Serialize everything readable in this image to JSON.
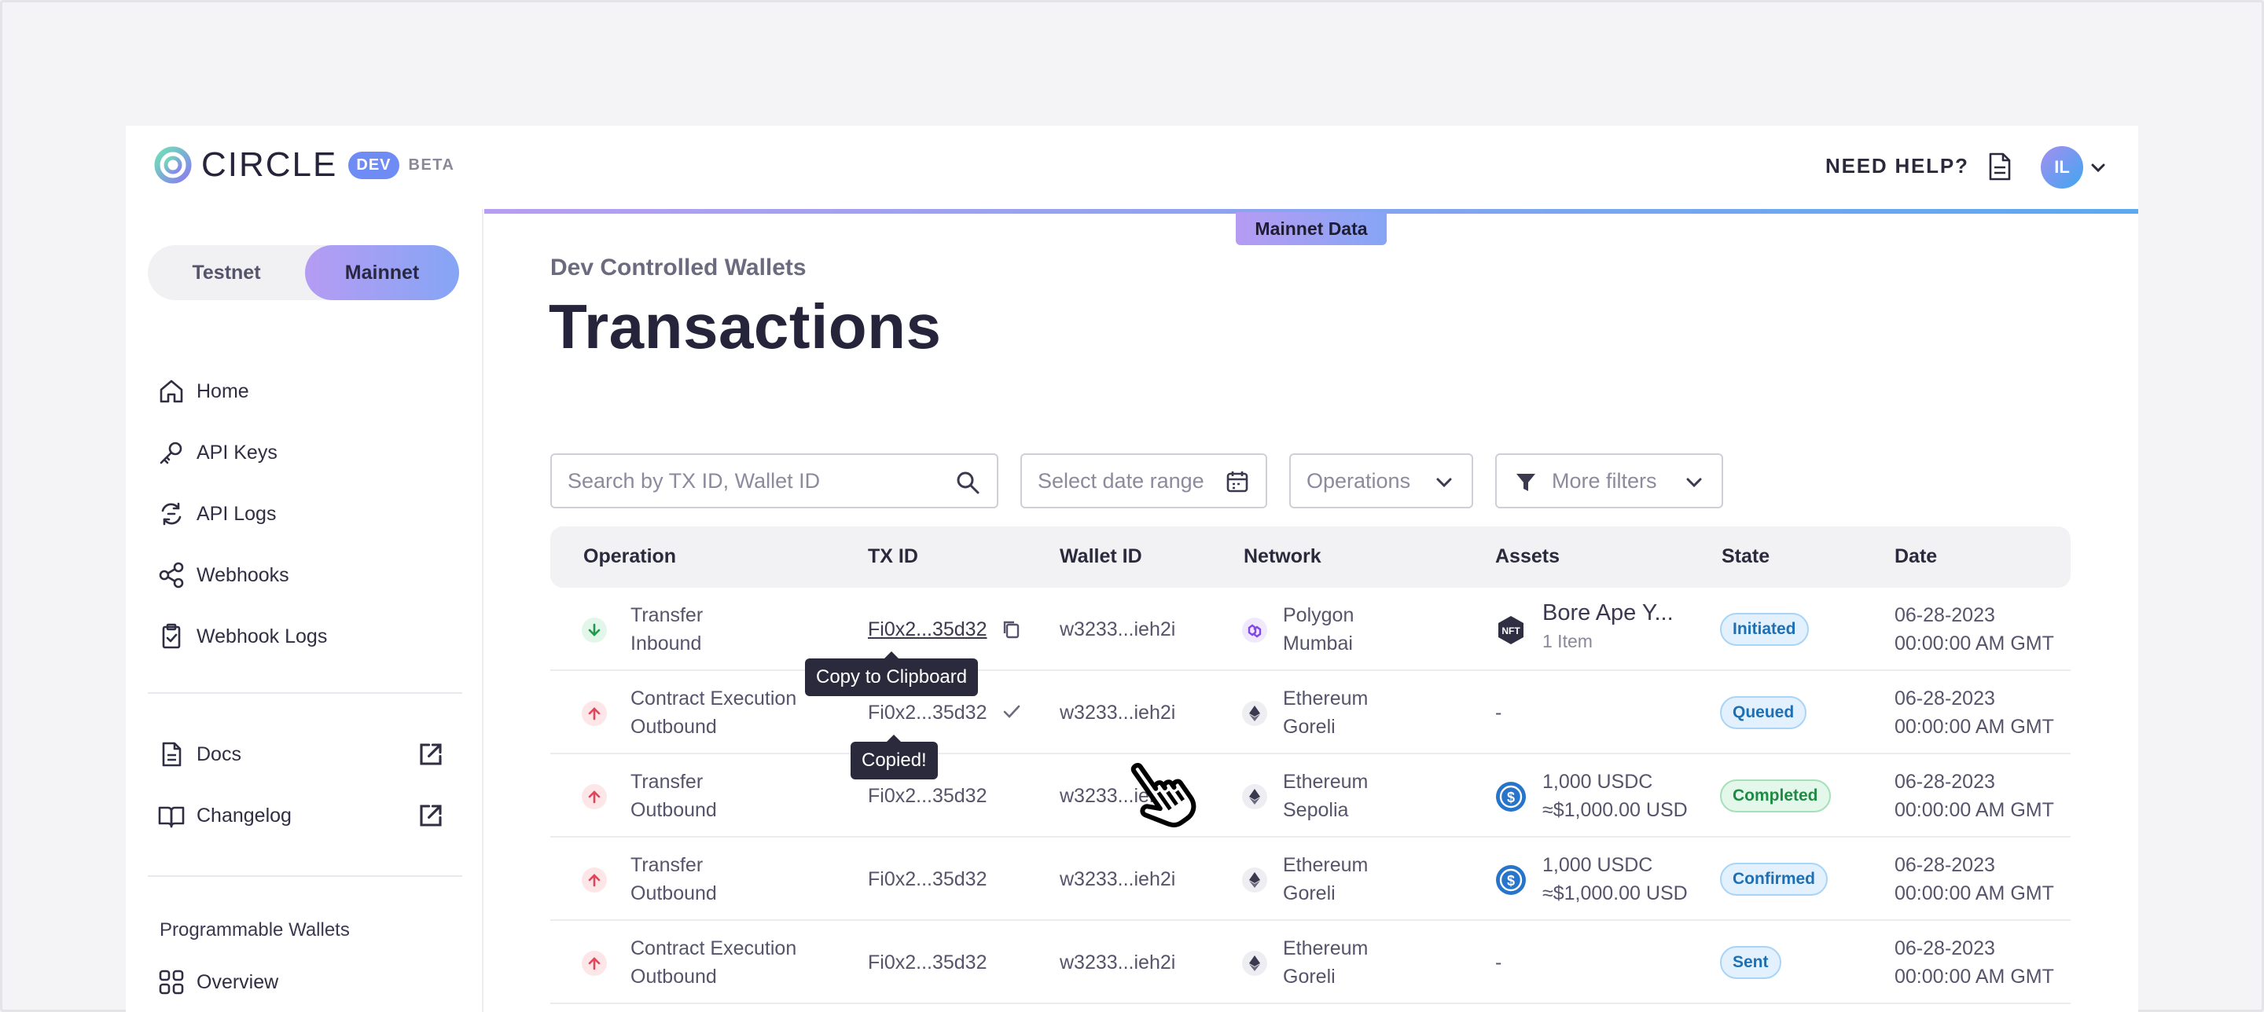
{
  "header": {
    "logo_text": "CIRCLE",
    "dev_badge": "DEV",
    "beta_label": "BETA",
    "help_label": "NEED HELP?",
    "avatar_initials": "IL"
  },
  "sidebar": {
    "network_toggle": {
      "testnet": "Testnet",
      "mainnet": "Mainnet",
      "selected": "Mainnet"
    },
    "items": [
      {
        "label": "Home",
        "icon": "home-icon"
      },
      {
        "label": "API Keys",
        "icon": "key-icon"
      },
      {
        "label": "API Logs",
        "icon": "refresh-log-icon"
      },
      {
        "label": "Webhooks",
        "icon": "webhook-icon"
      },
      {
        "label": "Webhook Logs",
        "icon": "clipboard-icon"
      }
    ],
    "external": [
      {
        "label": "Docs",
        "icon": "document-icon"
      },
      {
        "label": "Changelog",
        "icon": "book-icon"
      }
    ],
    "section_label": "Programmable Wallets",
    "section_items": [
      {
        "label": "Overview",
        "icon": "grid-icon"
      }
    ]
  },
  "main": {
    "mainnet_tag": "Mainnet Data",
    "breadcrumb": "Dev Controlled Wallets",
    "title": "Transactions",
    "filters": {
      "search_placeholder": "Search by TX ID, Wallet ID",
      "date_placeholder": "Select date range",
      "operations_label": "Operations",
      "more_filters_label": "More filters"
    },
    "table": {
      "headers": [
        "Operation",
        "TX ID",
        "Wallet ID",
        "Network",
        "Assets",
        "State",
        "Date"
      ],
      "rows": [
        {
          "operation": "Transfer",
          "direction": "Inbound",
          "tx_id": "Fi0x2...35d32",
          "wallet_id": "w3233...ieh2i",
          "network": "Polygon",
          "network_sub": "Mumbai",
          "asset": "Bore Ape Y...",
          "asset_sub": "1 Item",
          "asset_icon": "nft-icon",
          "state": "Initiated",
          "date": "06-28-2023",
          "time": "00:00:00 AM GMT"
        },
        {
          "operation": "Contract Execution",
          "direction": "Outbound",
          "tx_id": "Fi0x2...35d32",
          "wallet_id": "w3233...ieh2i",
          "network": "Ethereum",
          "network_sub": "Goreli",
          "asset": "-",
          "asset_sub": "",
          "asset_icon": "",
          "state": "Queued",
          "date": "06-28-2023",
          "time": "00:00:00 AM GMT"
        },
        {
          "operation": "Transfer",
          "direction": "Outbound",
          "tx_id": "Fi0x2...35d32",
          "wallet_id": "w3233...ieh2i",
          "network": "Ethereum",
          "network_sub": "Sepolia",
          "asset": "1,000 USDC",
          "asset_sub": "≈$1,000.00 USD",
          "asset_icon": "usdc-icon",
          "state": "Completed",
          "date": "06-28-2023",
          "time": "00:00:00 AM GMT"
        },
        {
          "operation": "Transfer",
          "direction": "Outbound",
          "tx_id": "Fi0x2...35d32",
          "wallet_id": "w3233...ieh2i",
          "network": "Ethereum",
          "network_sub": "Goreli",
          "asset": "1,000 USDC",
          "asset_sub": "≈$1,000.00 USD",
          "asset_icon": "usdc-icon",
          "state": "Confirmed",
          "date": "06-28-2023",
          "time": "00:00:00 AM GMT"
        },
        {
          "operation": "Contract Execution",
          "direction": "Outbound",
          "tx_id": "Fi0x2...35d32",
          "wallet_id": "w3233...ieh2i",
          "network": "Ethereum",
          "network_sub": "Goreli",
          "asset": "-",
          "asset_sub": "",
          "asset_icon": "",
          "state": "Sent",
          "date": "06-28-2023",
          "time": "00:00:00 AM GMT"
        }
      ]
    },
    "tooltips": {
      "copy": "Copy to Clipboard",
      "copied": "Copied!"
    }
  },
  "colors": {
    "accent_purple": "#b59cf3",
    "accent_blue": "#5aa9f2",
    "state_blue": "#1f6fb3",
    "state_green": "#1f8a44"
  }
}
